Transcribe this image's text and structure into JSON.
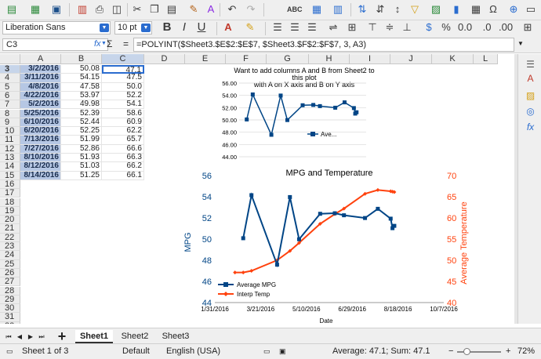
{
  "toolbar": {
    "items": [
      "new-doc",
      "template",
      "save",
      "export-pdf",
      "print",
      "print-preview",
      "cut",
      "copy",
      "paste",
      "clone-formatting",
      "clear-formatting",
      "undo",
      "redo",
      "spelling",
      "row",
      "column",
      "sort-asc",
      "sort-desc",
      "autofilter",
      "image",
      "chart",
      "pivot",
      "special-char",
      "hyperlink",
      "comment",
      "header-footer",
      "define-print-area",
      "freeze",
      "split",
      "show-draw",
      "more"
    ]
  },
  "format": {
    "font_name": "Liberation Sans",
    "font_size": "10 pt",
    "bold": "B",
    "italic": "I",
    "underline": "U"
  },
  "formula_bar": {
    "cell_ref": "C3",
    "fx": "fx",
    "sigma": "Σ",
    "equals": "=",
    "formula": "=POLYINT($Sheet3.$E$2:$E$7, $Sheet3.$F$2:$F$7, 3, A3)"
  },
  "columns": [
    "A",
    "B",
    "C",
    "D",
    "E",
    "F",
    "G",
    "H",
    "I",
    "J",
    "K",
    "L"
  ],
  "rows": [
    "3",
    "4",
    "5",
    "6",
    "7",
    "8",
    "9",
    "10",
    "11",
    "12",
    "13",
    "14",
    "15",
    "16",
    "17",
    "18",
    "19",
    "20",
    "21",
    "22",
    "23",
    "24",
    "25",
    "26",
    "27",
    "28",
    "29",
    "30",
    "31",
    "32"
  ],
  "table": [
    [
      "3/2/2016",
      "50.08",
      "47.1"
    ],
    [
      "3/11/2016",
      "54.15",
      "47.5"
    ],
    [
      "4/8/2016",
      "47.58",
      "50.0"
    ],
    [
      "4/22/2016",
      "53.97",
      "52.2"
    ],
    [
      "5/2/2016",
      "49.98",
      "54.1"
    ],
    [
      "5/25/2016",
      "52.39",
      "58.6"
    ],
    [
      "6/10/2016",
      "52.44",
      "60.9"
    ],
    [
      "6/20/2016",
      "52.25",
      "62.2"
    ],
    [
      "7/13/2016",
      "51.99",
      "65.7"
    ],
    [
      "7/27/2016",
      "52.86",
      "66.6"
    ],
    [
      "8/10/2016",
      "51.93",
      "66.3"
    ],
    [
      "8/12/2016",
      "51.03",
      "66.2"
    ],
    [
      "8/14/2016",
      "51.25",
      "66.1"
    ]
  ],
  "chart1": {
    "title_lines": [
      "Want to add columns A and B from Sheet2 to",
      "this plot",
      "with A on X axis and B on Y axis"
    ],
    "legend": "Ave...",
    "color": "#004586",
    "chart_data": {
      "type": "line",
      "y_ticks": [
        "56.00",
        "54.00",
        "52.00",
        "50.00",
        "48.00",
        "46.00",
        "44.00"
      ],
      "ylim": [
        44,
        56
      ],
      "x": [
        0,
        9,
        37,
        51,
        61,
        84,
        100,
        110,
        133,
        147,
        161,
        163,
        165
      ],
      "series": [
        {
          "name": "Ave...",
          "values": [
            50.08,
            54.15,
            47.58,
            53.97,
            49.98,
            52.39,
            52.44,
            52.25,
            51.99,
            52.86,
            51.93,
            51.03,
            51.25
          ]
        }
      ]
    }
  },
  "chart2": {
    "title": "MPG and Temperature",
    "ylabel": "MPG",
    "y2label": "Average Temperature",
    "xlabel": "Date",
    "mpg_color": "#004586",
    "temp_color": "#ff420e",
    "chart_data": {
      "type": "line",
      "x_ticks": [
        "1/31/2016",
        "3/21/2016",
        "5/10/2016",
        "6/29/2016",
        "8/18/2016",
        "10/7/2016"
      ],
      "x_tick_days": [
        0,
        50,
        100,
        150,
        200,
        250
      ],
      "y_ticks": [
        "56",
        "54",
        "52",
        "50",
        "48",
        "46",
        "44"
      ],
      "ylim": [
        44,
        56
      ],
      "y2_ticks": [
        "70",
        "65",
        "60",
        "55",
        "50",
        "45",
        "40"
      ],
      "y2lim": [
        40,
        70
      ],
      "series": [
        {
          "name": "Average MPG",
          "x": [
            "3/2/2016",
            "3/11/2016",
            "4/8/2016",
            "4/22/2016",
            "5/2/2016",
            "5/25/2016",
            "6/10/2016",
            "6/20/2016",
            "7/13/2016",
            "7/27/2016",
            "8/10/2016",
            "8/12/2016",
            "8/14/2016"
          ],
          "values": [
            50.08,
            54.15,
            47.58,
            53.97,
            49.98,
            52.39,
            52.44,
            52.25,
            51.99,
            52.86,
            51.93,
            51.03,
            51.25
          ]
        },
        {
          "name": "Interp Temp",
          "x": [
            "2/22/2016",
            "3/2/2016",
            "3/11/2016",
            "4/8/2016",
            "4/22/2016",
            "5/2/2016",
            "5/25/2016",
            "6/10/2016",
            "6/20/2016",
            "7/13/2016",
            "7/27/2016",
            "8/10/2016",
            "8/12/2016",
            "8/14/2016"
          ],
          "values": [
            47.1,
            47.1,
            47.5,
            50.0,
            52.2,
            54.1,
            58.6,
            60.9,
            62.2,
            65.7,
            66.6,
            66.3,
            66.2,
            66.1
          ]
        }
      ]
    }
  },
  "sheets": {
    "tabs": [
      "Sheet1",
      "Sheet2",
      "Sheet3"
    ],
    "active": "Sheet1"
  },
  "status": {
    "sheet": "Sheet 1 of 3",
    "style": "Default",
    "language": "English (USA)",
    "summary": "Average: 47.1; Sum: 47.1",
    "zoom": "72%"
  }
}
